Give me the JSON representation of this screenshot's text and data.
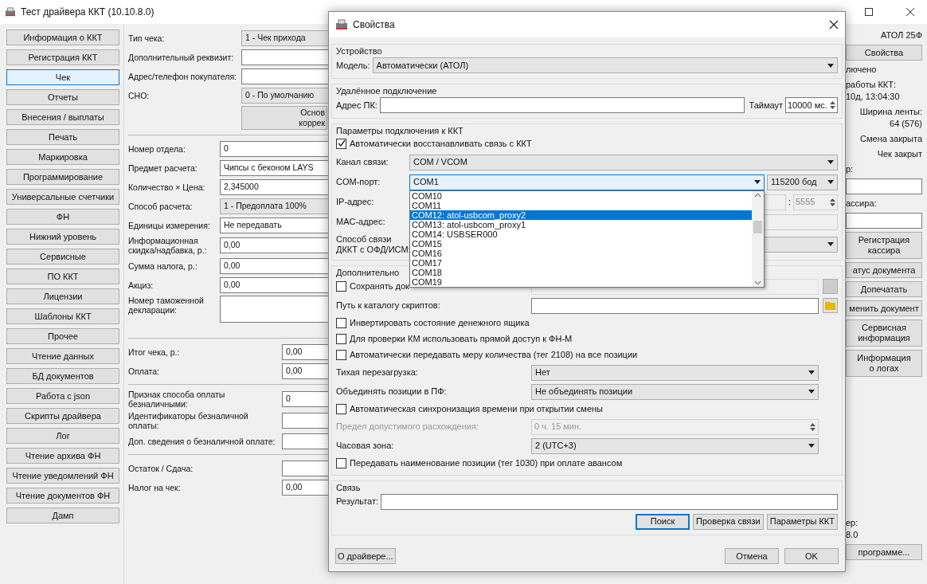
{
  "window": {
    "title": "Тест драйвера ККТ (10.10.8.0)"
  },
  "sidebar": {
    "items": [
      {
        "label": "Информация о ККТ",
        "selected": false
      },
      {
        "label": "Регистрация ККТ",
        "selected": false
      },
      {
        "label": "Чек",
        "selected": true
      },
      {
        "label": "Отчеты",
        "selected": false
      },
      {
        "label": "Внесения / выплаты",
        "selected": false
      },
      {
        "label": "Печать",
        "selected": false
      },
      {
        "label": "Маркировка",
        "selected": false
      },
      {
        "label": "Программирование",
        "selected": false
      },
      {
        "label": "Универсальные счетчики",
        "selected": false
      },
      {
        "label": "ФН",
        "selected": false
      },
      {
        "label": "Нижний уровень",
        "selected": false
      },
      {
        "label": "Сервисные",
        "selected": false
      },
      {
        "label": "ПО ККТ",
        "selected": false
      },
      {
        "label": "Лицензии",
        "selected": false
      },
      {
        "label": "Шаблоны ККТ",
        "selected": false
      },
      {
        "label": "Прочее",
        "selected": false
      },
      {
        "label": "Чтение данных",
        "selected": false
      },
      {
        "label": "БД документов",
        "selected": false
      },
      {
        "label": "Работа с json",
        "selected": false
      },
      {
        "label": "Скрипты драйвера",
        "selected": false
      },
      {
        "label": "Лог",
        "selected": false
      },
      {
        "label": "Чтение архива ФН",
        "selected": false
      },
      {
        "label": "Чтение уведомлений ФН",
        "selected": false
      },
      {
        "label": "Чтение документов ФН",
        "selected": false
      },
      {
        "label": "Дамп",
        "selected": false
      }
    ]
  },
  "receipt_form": {
    "sections": [
      {
        "rows": [
          {
            "kind": "combo",
            "label": "Тип чека:",
            "value": "1 - Чек прихода"
          },
          {
            "kind": "input",
            "label": "Дополнительный реквизит:"
          },
          {
            "kind": "input",
            "label": "Адрес/телефон покупателя:"
          },
          {
            "kind": "combo",
            "label": "СНО:",
            "value": "0 - По умолчанию"
          },
          {
            "kind": "button",
            "value": "Основ\nкоррек"
          }
        ]
      },
      {
        "rows": [
          {
            "kind": "input",
            "label": "Номер отдела:",
            "value": "0"
          },
          {
            "kind": "input",
            "label": "Предмет расчета:",
            "value": "Чипсы с беконом LAYS"
          },
          {
            "kind": "input",
            "label": "Количество × Цена:",
            "value": "2,345000"
          },
          {
            "kind": "combo",
            "label": "Способ расчета:",
            "value": "1 - Предоплата 100%"
          },
          {
            "kind": "input",
            "label": "Единицы измерения:",
            "value": "Не передавать"
          },
          {
            "kind": "input",
            "label": "Информационная скидка/надбавка, р.:",
            "value": "0,00"
          },
          {
            "kind": "input",
            "label": "Сумма налога, р.:",
            "value": "0,00"
          },
          {
            "kind": "input",
            "label": "Акциз:",
            "value": "0,00"
          },
          {
            "kind": "textarea",
            "label": "Номер таможенной декларации:"
          }
        ]
      },
      {
        "rows": [
          {
            "kind": "input",
            "label": "Итог чека, р.:",
            "value": "0,00"
          },
          {
            "kind": "input",
            "label": "Оплата:",
            "value": "0,00"
          }
        ]
      },
      {
        "rows": [
          {
            "kind": "input",
            "label": "Признак способа оплаты безналичными:",
            "value": "0"
          },
          {
            "kind": "input",
            "label": "Идентификаторы безналичной оплаты:"
          },
          {
            "kind": "input",
            "label": "Доп. сведения о безналичной оплате:"
          }
        ]
      },
      {
        "rows": [
          {
            "kind": "input",
            "label": "Остаток / Сдача:"
          },
          {
            "kind": "input",
            "label": "Налог на чек:",
            "value": "0,00"
          }
        ]
      }
    ]
  },
  "status_panel": {
    "items": [
      {
        "kind": "text_right",
        "text": "АТОЛ 25Ф"
      },
      {
        "kind": "button",
        "text": "Свойства"
      },
      {
        "kind": "text_left",
        "text": "лючено"
      },
      {
        "kind": "text_left",
        "text": "работы ККТ:\n10д, 13:04:30"
      },
      {
        "kind": "text_right",
        "text": "Ширина ленты:\n64 (576)"
      },
      {
        "kind": "text_right",
        "text": "Смена закрыта"
      },
      {
        "kind": "text_right",
        "text": "Чек закрыт"
      },
      {
        "kind": "text_left",
        "text": "р:"
      },
      {
        "kind": "input"
      },
      {
        "kind": "text_left",
        "text": "ассира:"
      },
      {
        "kind": "input"
      },
      {
        "kind": "button",
        "text": "Регистрация\nкассира"
      },
      {
        "kind": "button",
        "text": "атус документа"
      },
      {
        "kind": "button",
        "text": "Допечатать"
      },
      {
        "kind": "button",
        "text": "менить документ"
      },
      {
        "kind": "button",
        "text": "Сервисная\nинформация"
      },
      {
        "kind": "button",
        "text": "Информация\nо логах"
      },
      {
        "kind": "spacer"
      },
      {
        "kind": "text_left",
        "text": "ер:\n8.0"
      },
      {
        "kind": "button",
        "text": "программе..."
      }
    ]
  },
  "dialog": {
    "title": "Свойства",
    "device_group": {
      "title": "Устройство",
      "model_label": "Модель:",
      "model_value": "Автоматически (АТОЛ)"
    },
    "remote_group": {
      "title": "Удалённое подключение",
      "address_label": "Адрес ПК:",
      "timeout_label": "Таймаут",
      "timeout_value": "10000 мс."
    },
    "connection_group": {
      "title": "Параметры подключения к ККТ",
      "auto_reconnect": {
        "label": "Автоматически восстанавливать связь с ККТ",
        "checked": true
      },
      "channel_label": "Канал связи:",
      "channel_value": "COM / VCOM",
      "port_label": "COM-порт:",
      "port_value": "COM1",
      "baud_value": "115200 бод",
      "ip_label": "IP-адрес:",
      "ip_port_separator": ":",
      "ip_port_value": "5555",
      "mac_label": "MAC-адрес:",
      "ofd_label": "Способ связи\nДККТ с ОФД/ИСМ:",
      "port_dropdown": {
        "expanded": true,
        "options": [
          {
            "label": "COM10",
            "selected": false
          },
          {
            "label": "COM11",
            "selected": false
          },
          {
            "label": "COM12: atol-usbcom_proxy2",
            "selected": true
          },
          {
            "label": "COM13: atol-usbcom_proxy1",
            "selected": false
          },
          {
            "label": "COM14: USBSER000",
            "selected": false
          },
          {
            "label": "COM15",
            "selected": false
          },
          {
            "label": "COM16",
            "selected": false
          },
          {
            "label": "COM17",
            "selected": false
          },
          {
            "label": "COM18",
            "selected": false
          },
          {
            "label": "COM19",
            "selected": false
          }
        ]
      }
    },
    "extra_group": {
      "title": "Дополнительно",
      "rows": [
        {
          "kind": "checkbox_path",
          "label": "Сохранять док",
          "checked": false
        },
        {
          "kind": "path",
          "label": "Путь к каталогу скриптов:"
        },
        {
          "kind": "checkbox",
          "label": "Инвертировать состояние денежного ящика",
          "checked": false
        },
        {
          "kind": "checkbox",
          "label": "Для проверки КМ использовать прямой доступ к ФН-М",
          "checked": false
        },
        {
          "kind": "checkbox",
          "label": "Автоматически передавать меру количества (тег 2108) на все позиции",
          "checked": false
        },
        {
          "kind": "combo",
          "label": "Тихая перезагрузка:",
          "value": "Нет"
        },
        {
          "kind": "combo",
          "label": "Объединять позиции в ПФ:",
          "value": "Не объединять позиции"
        },
        {
          "kind": "checkbox",
          "label": "Автоматическая синхронизация времени при открытии смены",
          "checked": false
        },
        {
          "kind": "spin",
          "label": "Предел допустимого расхождения:",
          "value": "0 ч. 15 мин.",
          "disabled": true
        },
        {
          "kind": "combo",
          "label": "Часовая зона:",
          "value": "2 (UTC+3)"
        },
        {
          "kind": "checkbox",
          "label": "Передавать наименование позиции (тег 1030) при оплате авансом",
          "checked": false
        }
      ]
    },
    "link_group": {
      "title": "Связь",
      "result_label": "Результат:",
      "buttons": [
        {
          "label": "Поиск",
          "default": true
        },
        {
          "label": "Проверка связи",
          "default": false
        },
        {
          "label": "Параметры ККТ",
          "default": false
        }
      ]
    },
    "footer": {
      "about_button": "О драйвере...",
      "buttons": [
        "Отмена",
        "OK"
      ]
    }
  }
}
